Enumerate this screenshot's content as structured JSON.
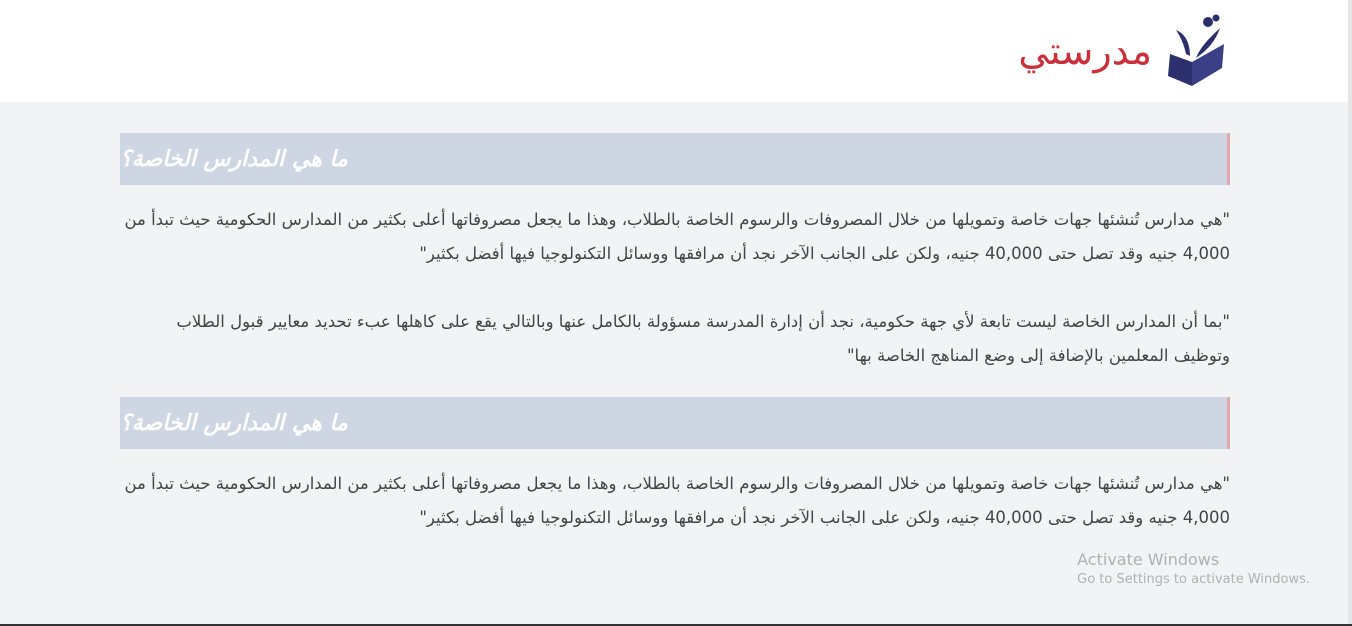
{
  "header": {
    "logo_text": "مدرستي",
    "logo_icon": "open-book-figure-icon"
  },
  "sections": [
    {
      "heading": "ما هي المدارس الخاصة؟",
      "paragraphs": [
        "\"هي مدارس تُنشئها جهات خاصة وتمويلها من خلال المصروفات والرسوم الخاصة بالطلاب، وهذا ما يجعل مصروفاتها أعلى بكثير من المدارس الحكومية حيث تبدأ من 4,000 جنيه وقد تصل حتى 40,000 جنيه، ولكن على الجانب الآخر نجد أن مرافقها ووسائل التكنولوجيا فيها أفضل بكثير\"",
        "\"بما أن المدارس الخاصة ليست تابعة لأي جهة حكومية، نجد أن إدارة المدرسة مسؤولة بالكامل عنها وبالتالي يقع على كاهلها عبء تحديد معايير قبول الطلاب وتوظيف المعلمين بالإضافة إلى وضع المناهج الخاصة بها\""
      ]
    },
    {
      "heading": "ما هي المدارس الخاصة؟",
      "paragraphs": [
        "\"هي مدارس تُنشئها جهات خاصة وتمويلها من خلال المصروفات والرسوم الخاصة بالطلاب، وهذا ما يجعل مصروفاتها أعلى بكثير من المدارس الحكومية حيث تبدأ من 4,000 جنيه وقد تصل حتى 40,000 جنيه، ولكن على الجانب الآخر نجد أن مرافقها ووسائل التكنولوجيا فيها أفضل بكثير\""
      ]
    }
  ],
  "watermark": {
    "title": "Activate Windows",
    "subtitle": "Go to Settings to activate Windows."
  },
  "colors": {
    "brand_red": "#c9303a",
    "brand_navy": "#2b2f6b",
    "heading_bg": "#cdd6e2",
    "heading_accent": "#e2a8ae",
    "page_bg": "#f2f3f5"
  }
}
